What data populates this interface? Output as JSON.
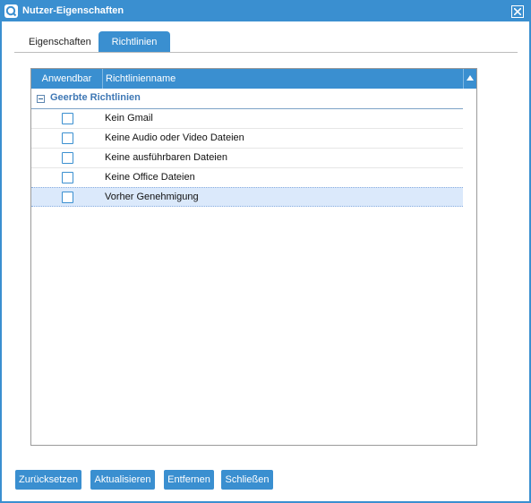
{
  "window": {
    "title": "Nutzer-Eigenschaften",
    "accent_color": "#3a8fd0",
    "icon": "app-logo-icon",
    "close_icon": "close-icon"
  },
  "tabs": [
    {
      "label": "Eigenschaften",
      "active": false
    },
    {
      "label": "Richtlinien",
      "active": true
    }
  ],
  "grid": {
    "columns": {
      "applicable": "Anwendbar",
      "name": "Richtlinienname"
    },
    "sort_icon": "sort-up-icon",
    "group": {
      "label": "Geerbte Richtlinien",
      "expanded": true
    },
    "rows": [
      {
        "name": "Kein Gmail",
        "checked": false,
        "selected": false
      },
      {
        "name": "Keine Audio oder Video Dateien",
        "checked": false,
        "selected": false
      },
      {
        "name": "Keine ausführbaren Dateien",
        "checked": false,
        "selected": false
      },
      {
        "name": "Keine Office Dateien",
        "checked": false,
        "selected": false
      },
      {
        "name": "Vorher Genehmigung",
        "checked": false,
        "selected": true
      }
    ]
  },
  "buttons": {
    "reset": "Zurücksetzen",
    "update": "Aktualisieren",
    "remove": "Entfernen",
    "close": "Schließen"
  }
}
